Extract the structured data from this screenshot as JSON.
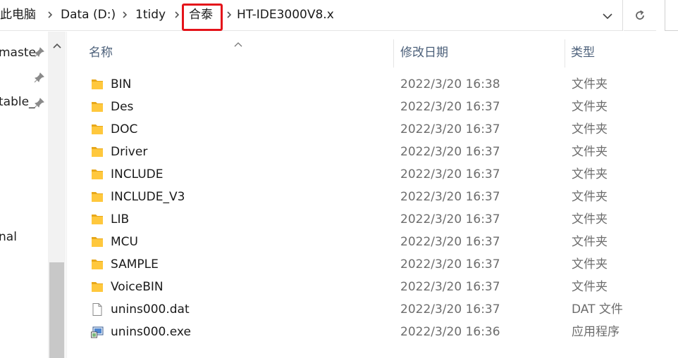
{
  "breadcrumb": {
    "items": [
      "此电脑",
      "Data (D:)",
      "1tidy",
      "合泰",
      "HT-IDE3000V8.x"
    ]
  },
  "nav": {
    "items": [
      "maste",
      "",
      "table_",
      "",
      "nal"
    ]
  },
  "columns": {
    "name": "名称",
    "date": "修改日期",
    "type": "类型"
  },
  "files": [
    {
      "name": "BIN",
      "date": "2022/3/20 16:38",
      "type": "文件夹",
      "icon": "folder-icon"
    },
    {
      "name": "Des",
      "date": "2022/3/20 16:37",
      "type": "文件夹",
      "icon": "folder-icon"
    },
    {
      "name": "DOC",
      "date": "2022/3/20 16:37",
      "type": "文件夹",
      "icon": "folder-icon"
    },
    {
      "name": "Driver",
      "date": "2022/3/20 16:37",
      "type": "文件夹",
      "icon": "folder-icon"
    },
    {
      "name": "INCLUDE",
      "date": "2022/3/20 16:37",
      "type": "文件夹",
      "icon": "folder-icon"
    },
    {
      "name": "INCLUDE_V3",
      "date": "2022/3/20 16:37",
      "type": "文件夹",
      "icon": "folder-icon"
    },
    {
      "name": "LIB",
      "date": "2022/3/20 16:37",
      "type": "文件夹",
      "icon": "folder-icon"
    },
    {
      "name": "MCU",
      "date": "2022/3/20 16:37",
      "type": "文件夹",
      "icon": "folder-icon"
    },
    {
      "name": "SAMPLE",
      "date": "2022/3/20 16:37",
      "type": "文件夹",
      "icon": "folder-icon"
    },
    {
      "name": "VoiceBIN",
      "date": "2022/3/20 16:37",
      "type": "文件夹",
      "icon": "folder-icon"
    },
    {
      "name": "unins000.dat",
      "date": "2022/3/20 16:37",
      "type": "DAT 文件",
      "icon": "file-icon"
    },
    {
      "name": "unins000.exe",
      "date": "2022/3/20 16:36",
      "type": "应用程序",
      "icon": "installer-icon"
    }
  ],
  "colors": {
    "highlight_box": "#e4131a",
    "folder": "#ffc83d",
    "header_text": "#4c607a"
  }
}
